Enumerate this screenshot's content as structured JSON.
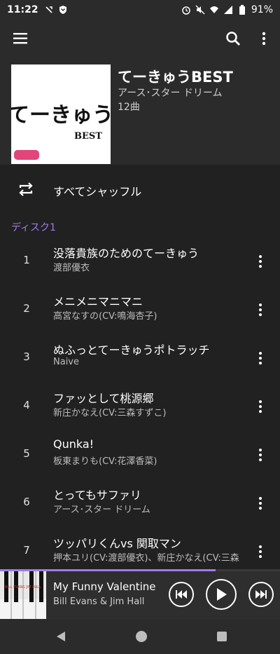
{
  "status": {
    "time": "11:22",
    "battery": "91%"
  },
  "album": {
    "title": "てーきゅうBEST",
    "artist": "アース･スター ドリーム",
    "count": "12曲",
    "cover_big": "てーきゅう",
    "cover_small": "BEST"
  },
  "shuffle_label": "すべてシャッフル",
  "disc_label": "ディスク1",
  "tracks": [
    {
      "num": "1",
      "title": "没落貴族のためのてーきゅう",
      "artist": "渡部優衣"
    },
    {
      "num": "2",
      "title": "メニメニマニマニ",
      "artist": "高宮なすの(CV:鳴海杏子)"
    },
    {
      "num": "3",
      "title": "ぬふっとてーきゅうポトラッチ",
      "artist": "Naive"
    },
    {
      "num": "4",
      "title": "ファッとして桃源郷",
      "artist": "新庄かなえ(CV:三森すずこ)"
    },
    {
      "num": "5",
      "title": "Qunka!",
      "artist": "板東まりも(CV:花澤香菜)"
    },
    {
      "num": "6",
      "title": "とってもサファリ",
      "artist": "アース･スター ドリーム"
    },
    {
      "num": "7",
      "title": "ツッパリくんvs 関取マン",
      "artist": "押本ユリ(CV:渡部優衣)、新庄かなえ(CV:三森"
    }
  ],
  "now_playing": {
    "song": "My Funny Valentine",
    "artist": "Bill Evans & Jim Hall",
    "thumb_text": "BILL EVANS\nJIM HALL",
    "progress_fraction": 0.77
  },
  "colors": {
    "accent": "#9e7ce6",
    "background": "#212121",
    "bar": "#2b2b2b"
  }
}
